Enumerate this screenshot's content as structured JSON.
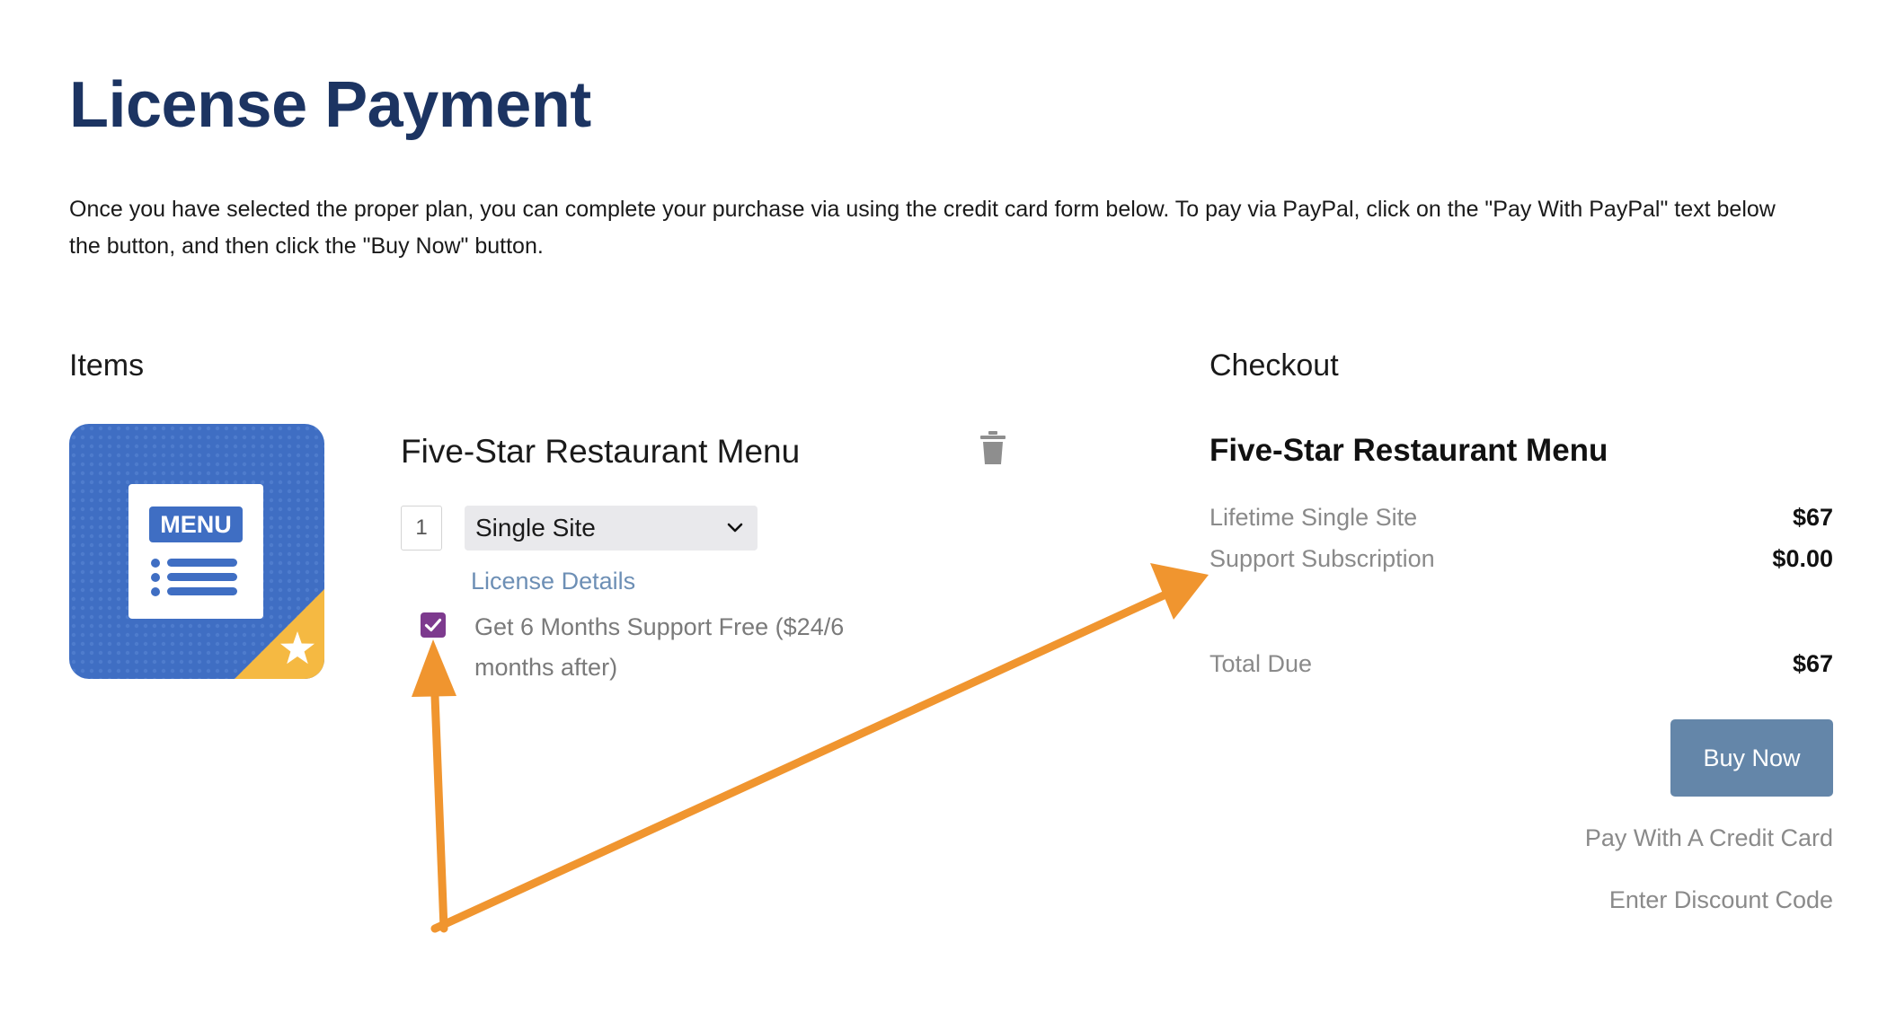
{
  "page": {
    "title": "License Payment",
    "intro": "Once you have selected the proper plan, you can complete your purchase via using the credit card form below. To pay via PayPal, click on the \"Pay With PayPal\" text below the button, and then click the \"Buy Now\" button."
  },
  "items": {
    "heading": "Items",
    "product": {
      "name": "Five-Star Restaurant Menu",
      "image_label": "MENU",
      "quantity": "1",
      "plan_selected": "Single Site",
      "license_details_label": "License Details",
      "support_checked": true,
      "support_label": "Get 6 Months Support Free ($24/6 months after)"
    }
  },
  "checkout": {
    "heading": "Checkout",
    "product_name": "Five-Star Restaurant Menu",
    "lines": [
      {
        "label": "Lifetime Single Site",
        "amount": "$67"
      },
      {
        "label": "Support Subscription",
        "amount": "$0.00"
      }
    ],
    "total": {
      "label": "Total Due",
      "amount": "$67"
    },
    "buy_button_label": "Buy Now",
    "pay_credit_label": "Pay With A Credit Card",
    "discount_label": "Enter Discount Code"
  },
  "colors": {
    "title": "#1c3462",
    "product_tile": "#3f6ec3",
    "tile_corner": "#f5b942",
    "checkbox": "#7d3a8e",
    "link": "#6d8fb5",
    "buy_button": "#6486a9",
    "annotation_arrow": "#f0952f"
  },
  "icons": [
    "trash-icon",
    "chevron-down-icon",
    "checkmark-icon",
    "menu-document-icon",
    "star-icon",
    "annotation-arrow"
  ]
}
